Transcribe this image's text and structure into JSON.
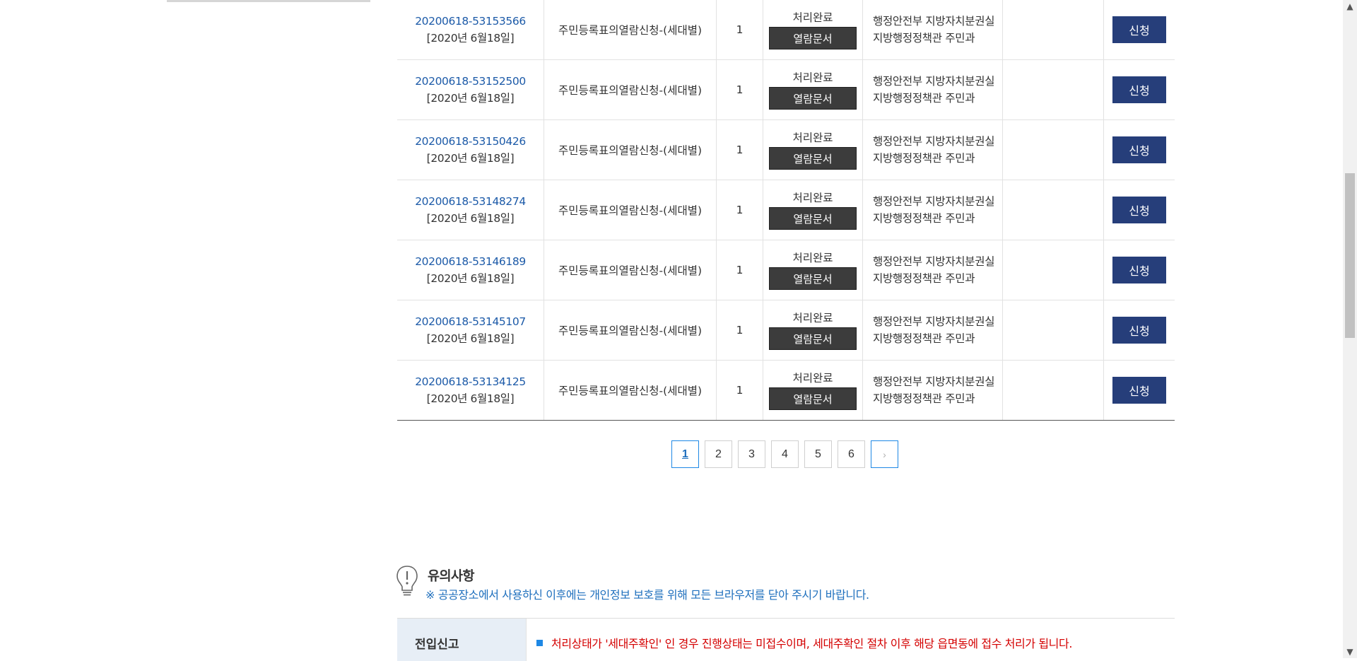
{
  "table": {
    "rows": [
      {
        "receipt_no": "20200618-53153566",
        "date": "[2020년 6월18일]",
        "service": "주민등록표의열람신청-(세대별)",
        "count": "1",
        "status": "처리완료",
        "doc_button": "열람문서",
        "org_line1": "행정안전부 지방자치분권실",
        "org_line2": "지방행정정책관 주민과",
        "apply_button": "신청"
      },
      {
        "receipt_no": "20200618-53152500",
        "date": "[2020년 6월18일]",
        "service": "주민등록표의열람신청-(세대별)",
        "count": "1",
        "status": "처리완료",
        "doc_button": "열람문서",
        "org_line1": "행정안전부 지방자치분권실",
        "org_line2": "지방행정정책관 주민과",
        "apply_button": "신청"
      },
      {
        "receipt_no": "20200618-53150426",
        "date": "[2020년 6월18일]",
        "service": "주민등록표의열람신청-(세대별)",
        "count": "1",
        "status": "처리완료",
        "doc_button": "열람문서",
        "org_line1": "행정안전부 지방자치분권실",
        "org_line2": "지방행정정책관 주민과",
        "apply_button": "신청"
      },
      {
        "receipt_no": "20200618-53148274",
        "date": "[2020년 6월18일]",
        "service": "주민등록표의열람신청-(세대별)",
        "count": "1",
        "status": "처리완료",
        "doc_button": "열람문서",
        "org_line1": "행정안전부 지방자치분권실",
        "org_line2": "지방행정정책관 주민과",
        "apply_button": "신청"
      },
      {
        "receipt_no": "20200618-53146189",
        "date": "[2020년 6월18일]",
        "service": "주민등록표의열람신청-(세대별)",
        "count": "1",
        "status": "처리완료",
        "doc_button": "열람문서",
        "org_line1": "행정안전부 지방자치분권실",
        "org_line2": "지방행정정책관 주민과",
        "apply_button": "신청"
      },
      {
        "receipt_no": "20200618-53145107",
        "date": "[2020년 6월18일]",
        "service": "주민등록표의열람신청-(세대별)",
        "count": "1",
        "status": "처리완료",
        "doc_button": "열람문서",
        "org_line1": "행정안전부 지방자치분권실",
        "org_line2": "지방행정정책관 주민과",
        "apply_button": "신청"
      },
      {
        "receipt_no": "20200618-53134125",
        "date": "[2020년 6월18일]",
        "service": "주민등록표의열람신청-(세대별)",
        "count": "1",
        "status": "처리완료",
        "doc_button": "열람문서",
        "org_line1": "행정안전부 지방자치분권실",
        "org_line2": "지방행정정책관 주민과",
        "apply_button": "신청"
      }
    ]
  },
  "pagination": {
    "pages": [
      "1",
      "2",
      "3",
      "4",
      "5",
      "6"
    ],
    "current": "1",
    "next_symbol": "›"
  },
  "notice": {
    "title": "유의사항",
    "subtitle": "※ 공공장소에서 사용하신 이후에는 개인정보 보호를 위해 모든 브라우저를 닫아 주시기 바랍니다.",
    "icon": "lightbulb-icon"
  },
  "notice_table": {
    "heading": "전입신고",
    "item1": "처리상태가 '세대주확인' 인 경우 진행상태는 미접수이며, 세대주확인 절차 이후 해당 읍면동에 접수 처리가 됩니다."
  },
  "colors": {
    "link": "#1c5aa8",
    "apply_button": "#263e7a",
    "doc_button": "#3c3c3c",
    "accent": "#1e88e5",
    "warning": "#d40000"
  }
}
